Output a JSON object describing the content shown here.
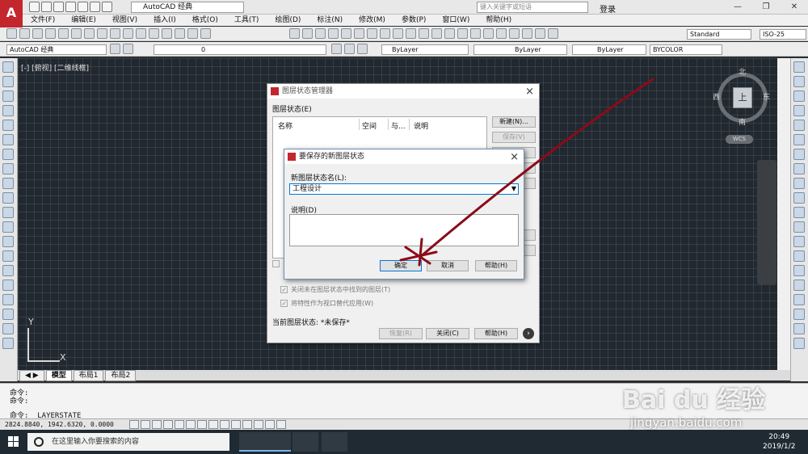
{
  "titlebar": {
    "workspace": "AutoCAD 经典",
    "search_placeholder": "键入关键字或短语",
    "login": "登录",
    "window_buttons": [
      "—",
      "❐",
      "✕"
    ]
  },
  "menus": [
    "文件(F)",
    "编辑(E)",
    "视图(V)",
    "插入(I)",
    "格式(O)",
    "工具(T)",
    "绘图(D)",
    "标注(N)",
    "修改(M)",
    "参数(P)",
    "窗口(W)",
    "帮助(H)"
  ],
  "toolbar2": {
    "text_style": "Standard",
    "dim_style": "ISO-25"
  },
  "toolbar3": {
    "workspace": "AutoCAD 经典",
    "layer": "0",
    "color": "ByLayer",
    "linetype": "ByLayer",
    "lineweight": "ByLayer",
    "plotstyle": "BYCOLOR"
  },
  "viewport": {
    "label": "[-] [俯视] [二维线框]",
    "viewcube": {
      "north": "北",
      "south": "南",
      "east": "东",
      "west": "西",
      "face": "上"
    },
    "wcs": "WCS",
    "ucs_x": "X",
    "ucs_y": "Y"
  },
  "layout_tabs": [
    "模型",
    "布局1",
    "布局2"
  ],
  "command": {
    "line1": "命令:",
    "line2": "命令:",
    "line3": "命令:  _LAYERSTATE"
  },
  "status": {
    "coords": "2824.8840, 1942.6320, 0.0000"
  },
  "taskbar": {
    "search_placeholder": "在这里输入你要搜索的内容",
    "time": "20:49",
    "date": "2019/1/2"
  },
  "layer_state_manager": {
    "title": "图层状态管理器",
    "list_label": "图层状态(E)",
    "columns": [
      "名称",
      "空间",
      "与...",
      "说明"
    ],
    "buttons": {
      "new": "新建(N)...",
      "save": "保存(V)"
    },
    "checkbox_1": "关闭未在图层状态中找到的图层(T)",
    "checkbox_2": "将特性作为视口替代应用(W)",
    "current_label": "当前图层状态: *未保存*",
    "restore": "恢复(R)",
    "close": "关闭(C)",
    "help": "帮助(H)"
  },
  "save_dialog": {
    "title": "要保存的新图层状态",
    "name_label": "新图层状态名(L):",
    "name_value": "工程设计",
    "desc_label": "说明(D)",
    "ok": "确定",
    "cancel": "取消",
    "help": "帮助(H)"
  },
  "watermark": {
    "brand": "Bai du 经验",
    "url": "jingyan.baidu.com"
  },
  "colors": {
    "canvas": "#212830",
    "annotation": "#8b0b18",
    "accent": "#0078d7"
  }
}
